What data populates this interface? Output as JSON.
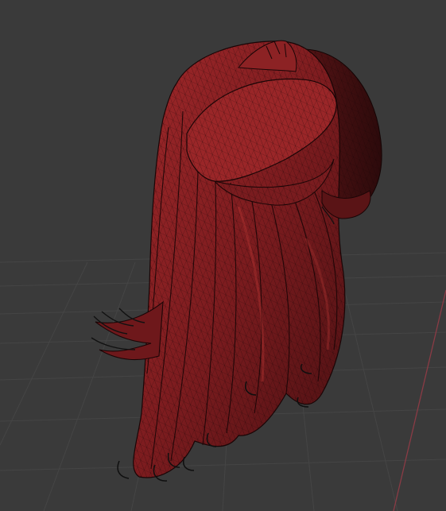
{
  "viewport": {
    "background_color": "#3a3a3a",
    "grid_color": "#4a4a4a",
    "grid_minor_color": "#444444",
    "axis_x_color": "#8a3b45",
    "view_mode": "wireframe-over-solid"
  },
  "object": {
    "name_icon": "hair-mesh",
    "base_color": "#7a1b1e",
    "highlight_color": "#b0302f",
    "shadow_color": "#3a0f10",
    "wire_color": "#1a0506"
  }
}
